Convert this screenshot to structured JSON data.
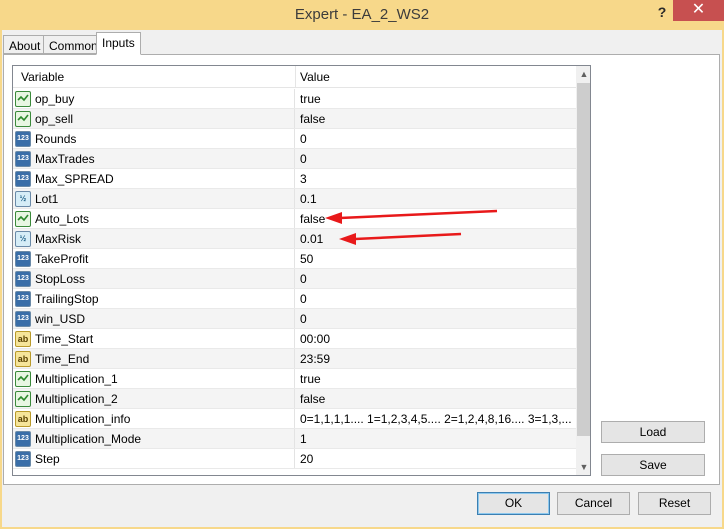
{
  "window": {
    "title": "Expert - EA_2_WS2",
    "help_glyph": "?",
    "close_glyph": "✕"
  },
  "tabs": [
    {
      "label": "About",
      "active": false
    },
    {
      "label": "Common",
      "active": false
    },
    {
      "label": "Inputs",
      "active": true
    }
  ],
  "table": {
    "columns": [
      "Variable",
      "Value"
    ],
    "rows": [
      {
        "name": "op_buy",
        "type": "bool",
        "value": "true"
      },
      {
        "name": "op_sell",
        "type": "bool",
        "value": "false"
      },
      {
        "name": "Rounds",
        "type": "int",
        "value": "0"
      },
      {
        "name": "MaxTrades",
        "type": "int",
        "value": "0"
      },
      {
        "name": "Max_SPREAD",
        "type": "int",
        "value": "3"
      },
      {
        "name": "Lot1",
        "type": "double",
        "value": "0.1"
      },
      {
        "name": "Auto_Lots",
        "type": "bool",
        "value": "false"
      },
      {
        "name": "MaxRisk",
        "type": "double",
        "value": "0.01"
      },
      {
        "name": "TakeProfit",
        "type": "int",
        "value": "50"
      },
      {
        "name": "StopLoss",
        "type": "int",
        "value": "0"
      },
      {
        "name": "TrailingStop",
        "type": "int",
        "value": "0"
      },
      {
        "name": "win_USD",
        "type": "int",
        "value": "0"
      },
      {
        "name": "Time_Start",
        "type": "string",
        "value": "00:00"
      },
      {
        "name": "Time_End",
        "type": "string",
        "value": "23:59"
      },
      {
        "name": "Multiplication_1",
        "type": "bool",
        "value": "true"
      },
      {
        "name": "Multiplication_2",
        "type": "bool",
        "value": "false"
      },
      {
        "name": "Multiplication_info",
        "type": "string",
        "value": "0=1,1,1,1....      1=1,2,3,4,5....      2=1,2,4,8,16....      3=1,3,..."
      },
      {
        "name": "Multiplication_Mode",
        "type": "int",
        "value": "1"
      },
      {
        "name": "Step",
        "type": "int",
        "value": "20"
      }
    ]
  },
  "icon_glyphs": {
    "int": "123",
    "double": "½",
    "bool": "✓",
    "string": "ab"
  },
  "side_buttons": {
    "load": "Load",
    "save": "Save"
  },
  "footer_buttons": {
    "ok": "OK",
    "cancel": "Cancel",
    "reset": "Reset"
  },
  "annotation_color": "#e8191a"
}
